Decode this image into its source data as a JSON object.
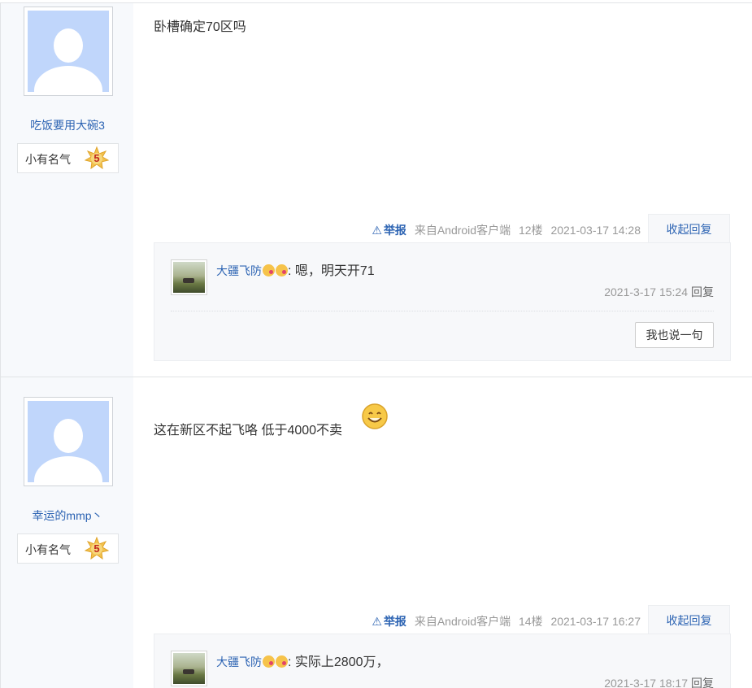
{
  "posts": [
    {
      "username": "吃饭要用大碗3",
      "level_label": "小有名气",
      "level_num": "5",
      "content": "卧槽确定70区吗",
      "report": "举报",
      "source": "来自Android客户端",
      "floor": "12楼",
      "datetime": "2021-03-17 14:28",
      "collapse": "收起回复",
      "reply": {
        "user": "大疆飞防",
        "text": ": 嗯，明天开71",
        "time": "2021-3-17 15:24",
        "reply_label": "回复",
        "say_button": "我也说一句"
      }
    },
    {
      "username": "幸运的mmp丶",
      "level_label": "小有名气",
      "level_num": "5",
      "content": "这在新区不起飞咯 低于4000不卖",
      "report": "举报",
      "source": "来自Android客户端",
      "floor": "14楼",
      "datetime": "2021-03-17 16:27",
      "collapse": "收起回复",
      "reply": {
        "user": "大疆飞防",
        "text": ": 实际上2800万，",
        "time": "2021-3-17 18:17",
        "reply_label": "回复"
      }
    }
  ],
  "icons": {
    "warning": "warning-icon",
    "star": "level-star-icon",
    "smiley": "smiley-emoji-icon",
    "kiss": "kiss-emoji-icon"
  },
  "colors": {
    "link": "#2d64b3",
    "avatar_bg": "#c0d6fb",
    "level_num": "#c1281f",
    "muted": "#999999"
  }
}
